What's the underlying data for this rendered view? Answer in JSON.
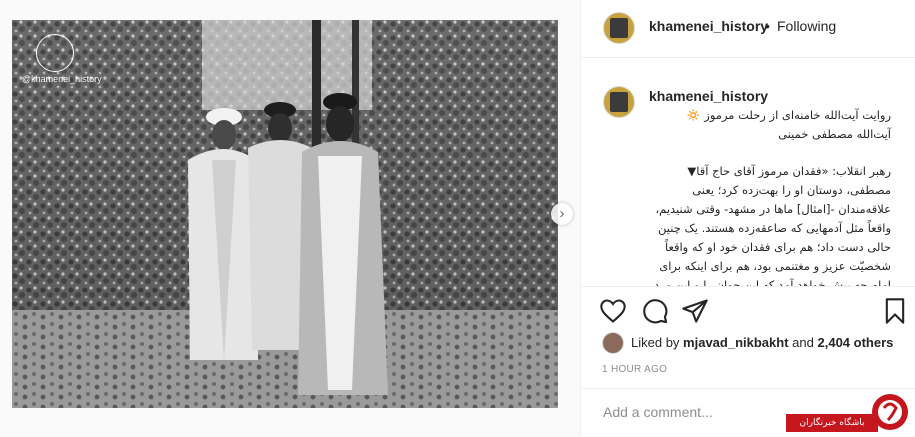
{
  "post": {
    "watermark": "@khamenei_history",
    "username": "khamenei_history",
    "follow_status": "Following",
    "separator": "•",
    "caption_lines": [
      "روایت آیت‌الله خامنه‌ای از رحلت مرموز 🔅",
      "آیت‌الله مصطفی خمینی"
    ],
    "body": "رهبر انقلاب: «فقدان مرموز آقای حاج آقا▼ مصطفی، دوستان او را بهت‌زده کرد؛ یعنی علاقه‌مندان -[امثال] ماها در مشهد- وقتی شنیدیم، واقعاً مثل آدمهایی که صاعقه‌زده هستند. یک چنین حالی دست داد؛ هم برای فقدان خود او که واقعاً شخصیّت عزیز و مغتنمی بود، هم برای اینکه برای امام چه پیش خواهد آمد که این جوان را و این مرد"
  },
  "likes": {
    "prefix": "Liked by",
    "user": "mjavad_nikbakht",
    "and": "and",
    "others": "2,404 others"
  },
  "timestamp": "1 HOUR AGO",
  "comment_input": {
    "placeholder": "Add a comment..."
  },
  "badge": {
    "text": "باشگاه خبرنگاران"
  },
  "icons": {
    "like": "heart-icon",
    "comment": "comment-icon",
    "share": "share-icon",
    "save": "bookmark-icon",
    "next": "chevron-right-icon"
  },
  "colors": {
    "text": "#262626",
    "muted": "#8e8e8e",
    "border": "#efefef",
    "badge_red": "#c4161c"
  }
}
